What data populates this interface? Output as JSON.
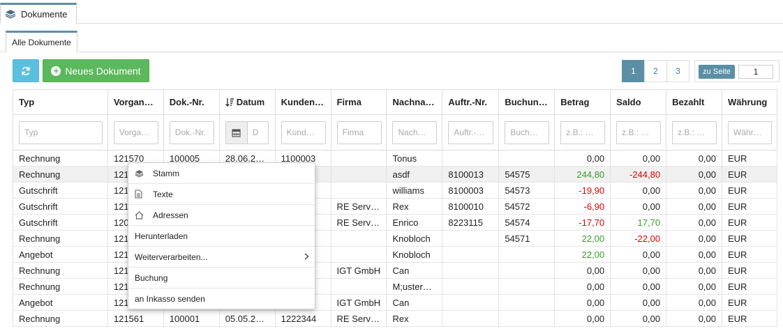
{
  "top_tab": {
    "label": "Dokumente",
    "icon": "layers-icon"
  },
  "sub_tab": {
    "label": "Alle Dokumente"
  },
  "toolbar": {
    "refresh_icon": "refresh-icon",
    "new_label": "Neues Dokument"
  },
  "pager": {
    "pages": [
      "1",
      "2",
      "3"
    ],
    "active": "1"
  },
  "per_page": {
    "label": "zu Seite",
    "value": "1"
  },
  "columns": [
    {
      "label": "Typ",
      "placeholder": "Typ"
    },
    {
      "label": "Vorgan…",
      "placeholder": "Vorga…"
    },
    {
      "label": "Dok.-Nr.",
      "placeholder": "Dok.-Nr."
    },
    {
      "label": "Datum",
      "placeholder": "D"
    },
    {
      "label": "Kunden…",
      "placeholder": "Kund…"
    },
    {
      "label": "Firma",
      "placeholder": "Firma"
    },
    {
      "label": "Nachna…",
      "placeholder": "Nach…"
    },
    {
      "label": "Auftr.-Nr.",
      "placeholder": "Auftr.-…"
    },
    {
      "label": "Buchun…",
      "placeholder": "Buch…"
    },
    {
      "label": "Betrag",
      "placeholder": "z.B.: …"
    },
    {
      "label": "Saldo",
      "placeholder": "z.B.: …"
    },
    {
      "label": "Bezahlt",
      "placeholder": "z.B.: …"
    },
    {
      "label": "Währung",
      "placeholder": "Währ…"
    }
  ],
  "rows": [
    [
      "Rechnung",
      "121570",
      "100005",
      "28.06.2…",
      "1100003",
      "",
      "Tonus",
      "",
      "",
      "0,00",
      "0,00",
      "0,00",
      "EUR"
    ],
    [
      "Rechnung",
      "121",
      "",
      "",
      "",
      "",
      "asdf",
      "8100013",
      "54575",
      "244,80",
      "-244,80",
      "0,00",
      "EUR"
    ],
    [
      "Gutschrift",
      "121",
      "",
      "",
      "",
      "",
      "williams",
      "8100003",
      "54573",
      "-19,90",
      "0,00",
      "0,00",
      "EUR"
    ],
    [
      "Gutschrift",
      "121",
      "",
      "",
      "",
      "RE Serv…",
      "Rex",
      "8100010",
      "54572",
      "-6,90",
      "0,00",
      "0,00",
      "EUR"
    ],
    [
      "Gutschrift",
      "120",
      "",
      "",
      "",
      "RE Serv…",
      "Enrico",
      "8223115",
      "54574",
      "-17,70",
      "17,70",
      "0,00",
      "EUR"
    ],
    [
      "Rechnung",
      "121",
      "",
      "",
      "",
      "",
      "Knobloch",
      "",
      "54571",
      "22,00",
      "-22,00",
      "0,00",
      "EUR"
    ],
    [
      "Angebot",
      "121",
      "",
      "",
      "",
      "",
      "Knobloch",
      "",
      "",
      "22,00",
      "0,00",
      "0,00",
      "EUR"
    ],
    [
      "Rechnung",
      "121",
      "",
      "",
      "",
      "IGT GmbH",
      "Can",
      "",
      "",
      "0,00",
      "0,00",
      "0,00",
      "EUR"
    ],
    [
      "Rechnung",
      "121",
      "",
      "",
      "",
      "",
      "M;uster…",
      "",
      "",
      "0,00",
      "0,00",
      "0,00",
      "EUR"
    ],
    [
      "Angebot",
      "121",
      "",
      "",
      "",
      "IGT GmbH",
      "Can",
      "",
      "",
      "0,00",
      "0,00",
      "0,00",
      "EUR"
    ],
    [
      "Rechnung",
      "121561",
      "100001",
      "05.05.2…",
      "1222344",
      "RE Serv…",
      "Rex",
      "",
      "",
      "0,00",
      "0,00",
      "0,00",
      "EUR"
    ]
  ],
  "context_menu": [
    {
      "label": "Stamm",
      "icon": "layers-icon"
    },
    {
      "label": "Texte",
      "icon": "document-icon"
    },
    {
      "label": "Adressen",
      "icon": "home-icon"
    },
    {
      "label": "Herunterladen",
      "icon": ""
    },
    {
      "label": "Weiterverarbeiten...",
      "icon": "",
      "submenu": true
    },
    {
      "label": "Buchung",
      "icon": ""
    },
    {
      "label": "an Inkasso senden",
      "icon": ""
    }
  ],
  "colors": {
    "accent": "#5b8fa5",
    "refresh_button": "#5bc0de",
    "new_button": "#5cb85c",
    "positive": "#3a9a2a",
    "negative": "#dd0000"
  }
}
